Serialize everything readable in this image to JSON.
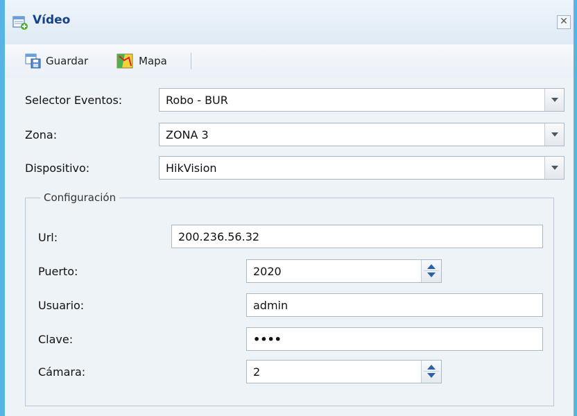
{
  "window": {
    "title": "Vídeo",
    "close_symbol": "✕"
  },
  "toolbar": {
    "buttons": [
      {
        "label": "Guardar",
        "icon": "save-icon"
      },
      {
        "label": "Mapa",
        "icon": "map-icon"
      }
    ]
  },
  "form": {
    "selector_eventos": {
      "label": "Selector Eventos:",
      "value": "Robo - BUR"
    },
    "zona": {
      "label": "Zona:",
      "value": "ZONA 3"
    },
    "dispositivo": {
      "label": "Dispositivo:",
      "value": "HikVision"
    }
  },
  "config": {
    "legend": "Configuración",
    "url": {
      "label": "Url:",
      "value": "200.236.56.32"
    },
    "puerto": {
      "label": "Puerto:",
      "value": "2020"
    },
    "usuario": {
      "label": "Usuario:",
      "value": "admin"
    },
    "clave": {
      "label": "Clave:",
      "value": "••••"
    },
    "camara": {
      "label": "Cámara:",
      "value": "2"
    }
  },
  "colors": {
    "window_border": "#55b6e6",
    "title_text": "#15428b",
    "spinner_arrow": "#2a62a8"
  }
}
